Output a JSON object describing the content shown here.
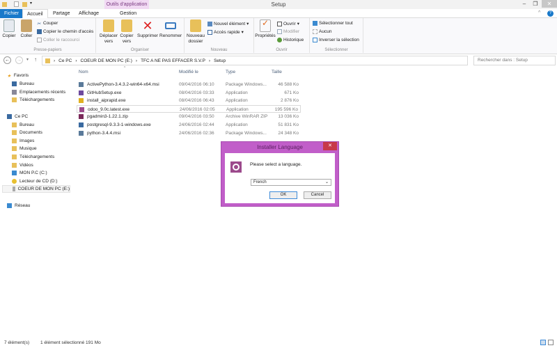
{
  "window": {
    "title": "Setup",
    "context_tab": "Outils d'application"
  },
  "tabs": [
    "Fichier",
    "Accueil",
    "Partage",
    "Affichage",
    "Gestion"
  ],
  "ribbon": {
    "presse_papiers": {
      "label": "Presse-papiers",
      "copier": "Copier",
      "coller": "Coller",
      "couper": "Couper",
      "copier_chemin": "Copier le chemin d'accès",
      "coller_raccourci": "Coller le raccourci"
    },
    "organiser": {
      "label": "Organiser",
      "deplacer": "Déplacer vers",
      "copier_vers": "Copier vers",
      "supprimer": "Supprimer",
      "renommer": "Renommer"
    },
    "nouveau": {
      "label": "Nouveau",
      "nouveau_dossier": "Nouveau dossier",
      "nouvel_element": "Nouvel élément",
      "acces_rapide": "Accès rapide"
    },
    "ouvrir": {
      "label": "Ouvrir",
      "proprietes": "Propriétés",
      "ouvrir": "Ouvrir",
      "modifier": "Modifier",
      "historique": "Historique"
    },
    "selectionner": {
      "label": "Sélectionner",
      "tout": "Sélectionner tout",
      "aucun": "Aucun",
      "inverser": "Inverser la sélection"
    }
  },
  "address": {
    "crumbs": [
      "Ce PC",
      "COEUR DE MON PC (E:)",
      "TFC A NE PAS EFFACER S.V.P",
      "Setup"
    ],
    "search_placeholder": "Rechercher dans : Setup"
  },
  "nav": {
    "favoris": "Favoris",
    "fav_items": [
      "Bureau",
      "Emplacements récents",
      "Téléchargements"
    ],
    "cepc": "Ce PC",
    "pc_items": [
      "Bureau",
      "Documents",
      "Images",
      "Musique",
      "Téléchargements",
      "Vidéos",
      "MON P.C (C:)",
      "Lecteur de CD (D:)",
      "COEUR DE MON PC (E:)"
    ],
    "reseau": "Réseau"
  },
  "columns": [
    "Nom",
    "Modifié le",
    "Type",
    "Taille"
  ],
  "files": [
    {
      "name": "ActivePython-3.4.3.2-win64-x64.msi",
      "date": "09/04/2016 06:10",
      "type": "Package Windows...",
      "size": "46 588 Ko",
      "color": "#5a7a9a"
    },
    {
      "name": "GitHubSetup.exe",
      "date": "08/04/2016 03:33",
      "type": "Application",
      "size": "671 Ko",
      "color": "#6e4a9e"
    },
    {
      "name": "install_aiprapid.exe",
      "date": "08/04/2016 06:43",
      "type": "Application",
      "size": "2 876 Ko",
      "color": "#e0b020"
    },
    {
      "name": "odoo_9.0c.latest.exe",
      "date": "24/06/2016 02:05",
      "type": "Application",
      "size": "195 596 Ko",
      "color": "#9c4a8c"
    },
    {
      "name": "pgadmin3-1.22.1.zip",
      "date": "09/04/2016 03:50",
      "type": "Archive WinRAR ZIP",
      "size": "13 036 Ko",
      "color": "#7a2a5a"
    },
    {
      "name": "postgresql-9.3.3-1-windows.exe",
      "date": "24/06/2016 02:44",
      "type": "Application",
      "size": "51 831 Ko",
      "color": "#3a6aa0"
    },
    {
      "name": "python-3.4.4.msi",
      "date": "24/06/2016 02:36",
      "type": "Package Windows...",
      "size": "24 348 Ko",
      "color": "#5a7a9a"
    }
  ],
  "dialog": {
    "title": "Installer Language",
    "prompt": "Please select a language.",
    "selected": "French",
    "ok": "OK",
    "cancel": "Cancel",
    "accent": "#c15ec9"
  },
  "status": {
    "count": "7 élément(s)",
    "selection": "1 élément sélectionné  191 Mo"
  }
}
